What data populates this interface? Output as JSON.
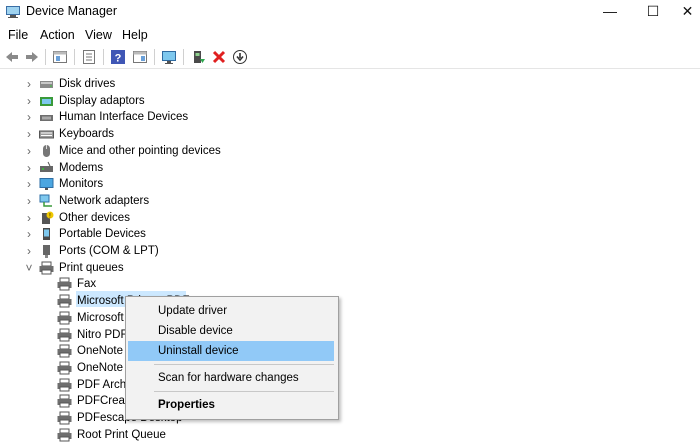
{
  "window": {
    "title": "Device Manager",
    "minimize": "—",
    "maximize": "☐",
    "close": "✕"
  },
  "menu": [
    "File",
    "Action",
    "View",
    "Help"
  ],
  "toolbar_icons": [
    "back-arrow-icon",
    "forward-arrow-icon",
    "console-tree-icon",
    "properties-icon",
    "help-icon",
    "action-pane-icon",
    "monitor-scan-icon",
    "update-driver-icon",
    "uninstall-x-icon",
    "download-driver-icon"
  ],
  "tree": {
    "categories": [
      {
        "label": "Disk drives",
        "icon": "disk-drive-icon",
        "expanded": false
      },
      {
        "label": "Display adaptors",
        "icon": "display-adapter-icon",
        "expanded": false
      },
      {
        "label": "Human Interface Devices",
        "icon": "hid-icon",
        "expanded": false
      },
      {
        "label": "Keyboards",
        "icon": "keyboard-icon",
        "expanded": false
      },
      {
        "label": "Mice and other pointing devices",
        "icon": "mouse-icon",
        "expanded": false
      },
      {
        "label": "Modems",
        "icon": "modem-icon",
        "expanded": false
      },
      {
        "label": "Monitors",
        "icon": "monitor-icon",
        "expanded": false
      },
      {
        "label": "Network adapters",
        "icon": "network-adapter-icon",
        "expanded": false
      },
      {
        "label": "Other devices",
        "icon": "other-devices-icon",
        "expanded": false
      },
      {
        "label": "Portable Devices",
        "icon": "portable-device-icon",
        "expanded": false
      },
      {
        "label": "Ports (COM & LPT)",
        "icon": "port-icon",
        "expanded": false
      },
      {
        "label": "Print queues",
        "icon": "printer-icon",
        "expanded": true
      }
    ],
    "print_queue_children": [
      {
        "label": "Fax"
      },
      {
        "label": "Microsoft Print to PDF",
        "selected": true
      },
      {
        "label": "Microsoft"
      },
      {
        "label": "Nitro PDF"
      },
      {
        "label": "OneNote"
      },
      {
        "label": "OneNote"
      },
      {
        "label": "PDF Archit"
      },
      {
        "label": "PDFCreato"
      },
      {
        "label": "PDFescape Desktop"
      },
      {
        "label": "Root Print Queue"
      }
    ]
  },
  "context_menu": {
    "items": [
      {
        "label": "Update driver"
      },
      {
        "label": "Disable device"
      },
      {
        "label": "Uninstall device",
        "highlighted": true
      },
      {
        "label": "Scan for hardware changes"
      },
      {
        "label": "Properties",
        "bold": true
      }
    ]
  },
  "colors": {
    "selection": "#cce8ff",
    "menu_highlight": "#91c9f7",
    "menu_bg": "#f2f2f2"
  }
}
